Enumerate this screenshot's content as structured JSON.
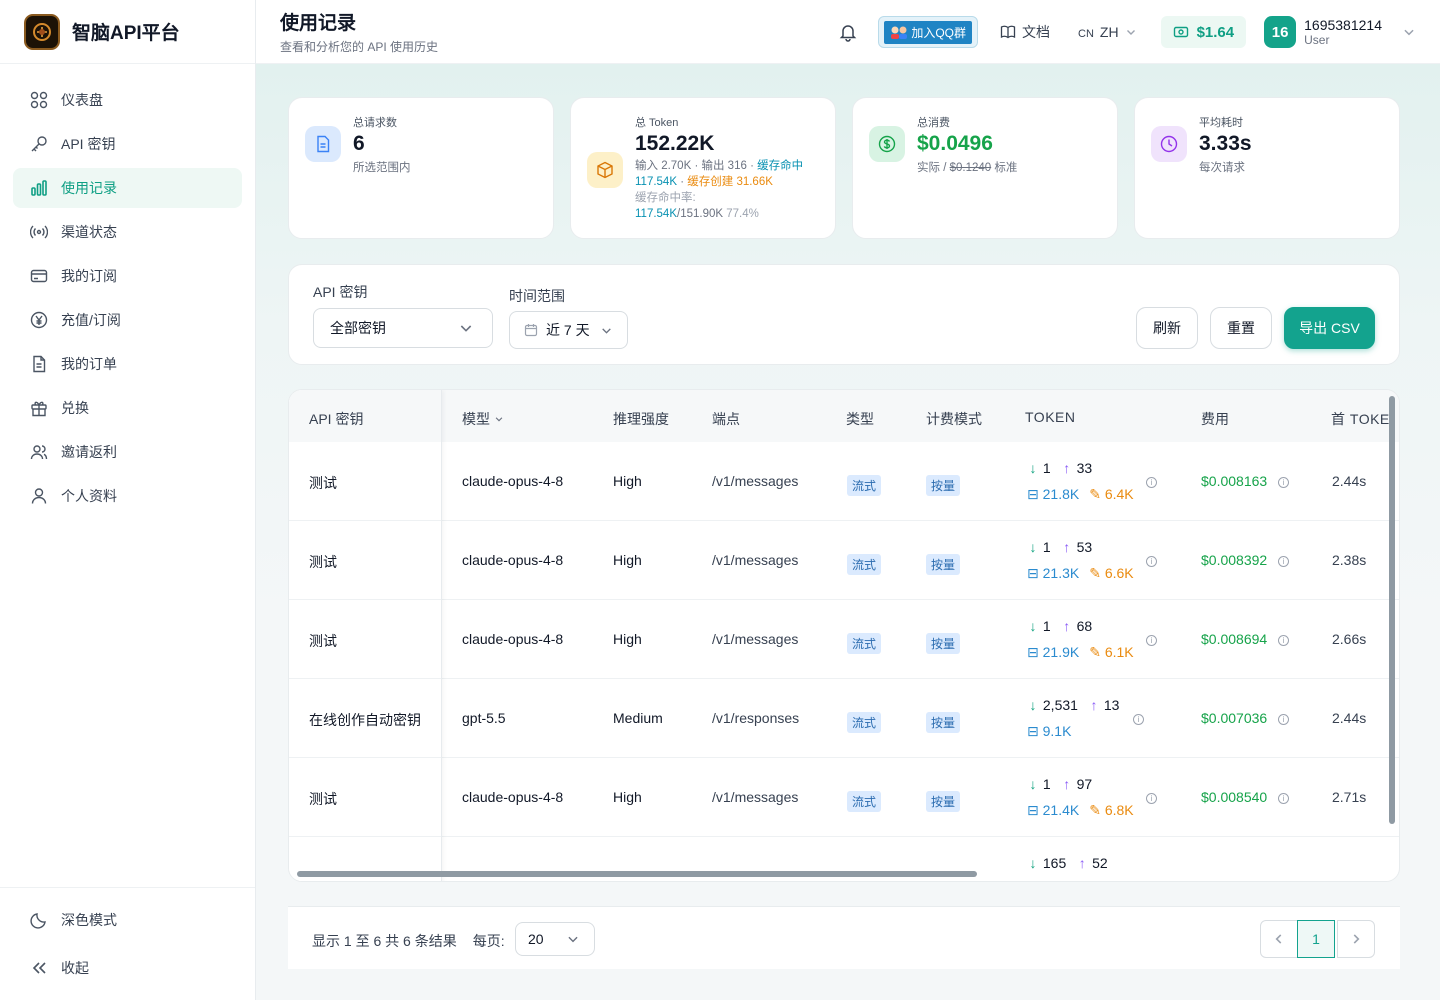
{
  "brand": {
    "name": "智脑API平台"
  },
  "sidebar": {
    "items": [
      {
        "label": "仪表盘",
        "icon": "grid-icon"
      },
      {
        "label": "API 密钥",
        "icon": "key-icon"
      },
      {
        "label": "使用记录",
        "icon": "bar-chart-icon"
      },
      {
        "label": "渠道状态",
        "icon": "signal-icon"
      },
      {
        "label": "我的订阅",
        "icon": "credit-card-icon"
      },
      {
        "label": "充值/订阅",
        "icon": "yen-icon"
      },
      {
        "label": "我的订单",
        "icon": "document-icon"
      },
      {
        "label": "兑换",
        "icon": "gift-icon"
      },
      {
        "label": "邀请返利",
        "icon": "users-icon"
      },
      {
        "label": "个人资料",
        "icon": "user-icon"
      }
    ],
    "active_index": 2,
    "bottom": {
      "dark_mode": "深色模式",
      "collapse": "收起"
    }
  },
  "header": {
    "title": "使用记录",
    "subtitle": "查看和分析您的 API 使用历史",
    "qq_label": "加入QQ群",
    "docs_label": "文档",
    "lang_flag": "CN",
    "lang_code": "ZH",
    "balance": "$1.64",
    "user_avatar": "16",
    "user_name": "1695381214",
    "user_role": "User"
  },
  "stats": [
    {
      "label": "总请求数",
      "value": "6",
      "sub": "所选范围内"
    },
    {
      "label": "总 Token",
      "value": "152.22K",
      "input": "输入 2.70K",
      "output": "输出 316",
      "cache_hit_label": "缓存命中",
      "cache_hit": "117.54K",
      "cache_create_label": "缓存创建",
      "cache_create": "31.66K",
      "hit_rate_label": "缓存命中率:",
      "hit_rate_a": "117.54K",
      "hit_rate_b": "/151.90K",
      "hit_rate_pct": "77.4%"
    },
    {
      "label": "总消费",
      "value": "$0.0496",
      "sub_a": "实际 /",
      "sub_b": "$0.1240",
      "sub_c": "标准"
    },
    {
      "label": "平均耗时",
      "value": "3.33s",
      "sub": "每次请求"
    }
  ],
  "filters": {
    "key_label": "API 密钥",
    "key_value": "全部密钥",
    "range_label": "时间范围",
    "range_value": "近 7 天",
    "refresh": "刷新",
    "reset": "重置",
    "export": "导出 CSV"
  },
  "table": {
    "columns": [
      "API 密钥",
      "模型",
      "推理强度",
      "端点",
      "类型",
      "计费模式",
      "TOKEN",
      "费用",
      "首 TOKE"
    ],
    "rows": [
      {
        "key": "测试",
        "model": "claude-opus-4-8",
        "effort": "High",
        "endpoint": "/v1/messages",
        "type": "流式",
        "billing": "按量",
        "in": "1",
        "out": "33",
        "cache_read": "21.8K",
        "cache_write": "6.4K",
        "cost": "$0.008163",
        "ttft": "2.44s"
      },
      {
        "key": "测试",
        "model": "claude-opus-4-8",
        "effort": "High",
        "endpoint": "/v1/messages",
        "type": "流式",
        "billing": "按量",
        "in": "1",
        "out": "53",
        "cache_read": "21.3K",
        "cache_write": "6.6K",
        "cost": "$0.008392",
        "ttft": "2.38s"
      },
      {
        "key": "测试",
        "model": "claude-opus-4-8",
        "effort": "High",
        "endpoint": "/v1/messages",
        "type": "流式",
        "billing": "按量",
        "in": "1",
        "out": "68",
        "cache_read": "21.9K",
        "cache_write": "6.1K",
        "cost": "$0.008694",
        "ttft": "2.66s"
      },
      {
        "key": "在线创作自动密钥",
        "model": "gpt-5.5",
        "effort": "Medium",
        "endpoint": "/v1/responses",
        "type": "流式",
        "billing": "按量",
        "in": "2,531",
        "out": "13",
        "cache_read": "9.1K",
        "cache_write": "",
        "cost": "$0.007036",
        "ttft": "2.44s"
      },
      {
        "key": "测试",
        "model": "claude-opus-4-8",
        "effort": "High",
        "endpoint": "/v1/messages",
        "type": "流式",
        "billing": "按量",
        "in": "1",
        "out": "97",
        "cache_read": "21.4K",
        "cache_write": "6.8K",
        "cost": "$0.008540",
        "ttft": "2.71s"
      },
      {
        "key": "",
        "model": "",
        "effort": "",
        "endpoint": "",
        "type": "",
        "billing": "",
        "in": "165",
        "out": "52",
        "cache_read": "",
        "cache_write": "",
        "cost": "",
        "ttft": ""
      }
    ]
  },
  "pagination": {
    "summary": "显示 1 至 6 共 6 条结果",
    "per_page_label": "每页:",
    "per_page": "20",
    "current_page": "1"
  },
  "colors": {
    "accent": "#13a38e",
    "cost_green": "#16a34a",
    "cache_blue": "#2b8bcf",
    "cache_orange": "#ea8b10"
  }
}
